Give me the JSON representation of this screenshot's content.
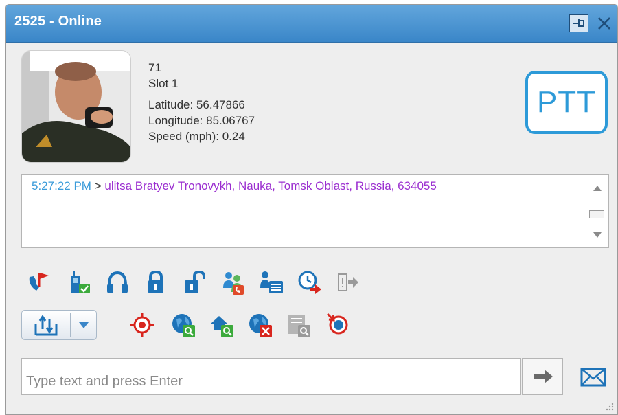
{
  "window": {
    "title": "2525 - Online",
    "pin_icon": "pin-icon",
    "close_icon": "close-icon",
    "accent": "#3a86c8"
  },
  "profile": {
    "avatar_icon": "officer-photo",
    "id": "71",
    "slot": "Slot 1",
    "latitude": "Latitude: 56.47866",
    "longitude": "Longitude: 85.06767",
    "speed": "Speed (mph): 0.24"
  },
  "ptt": {
    "label": "PTT",
    "color": "#2d9ad8"
  },
  "log": {
    "entries": [
      {
        "time": "5:27:22 PM",
        "separator": ">",
        "text": "ulitsa Bratyev Tronovykh, Nauka, Tomsk Oblast, Russia, 634055"
      }
    ]
  },
  "toolbar": {
    "row1": [
      "call-alert-icon",
      "radio-check-icon",
      "monitor-headset-icon",
      "lock-icon",
      "unlock-icon",
      "group-call-icon",
      "radio-info-icon",
      "schedule-forward-icon",
      "exit-disabled-icon"
    ],
    "row2": [
      "locate-target-icon",
      "globe-search-icon",
      "home-search-icon",
      "globe-delete-icon",
      "history-search-icon",
      "target-cancel-icon"
    ],
    "split_button_icon": "upload-sort-icon"
  },
  "message": {
    "placeholder": "Type text and press Enter",
    "value": ""
  },
  "send_icon": "arrow-right-icon",
  "mail_icon": "envelope-icon"
}
